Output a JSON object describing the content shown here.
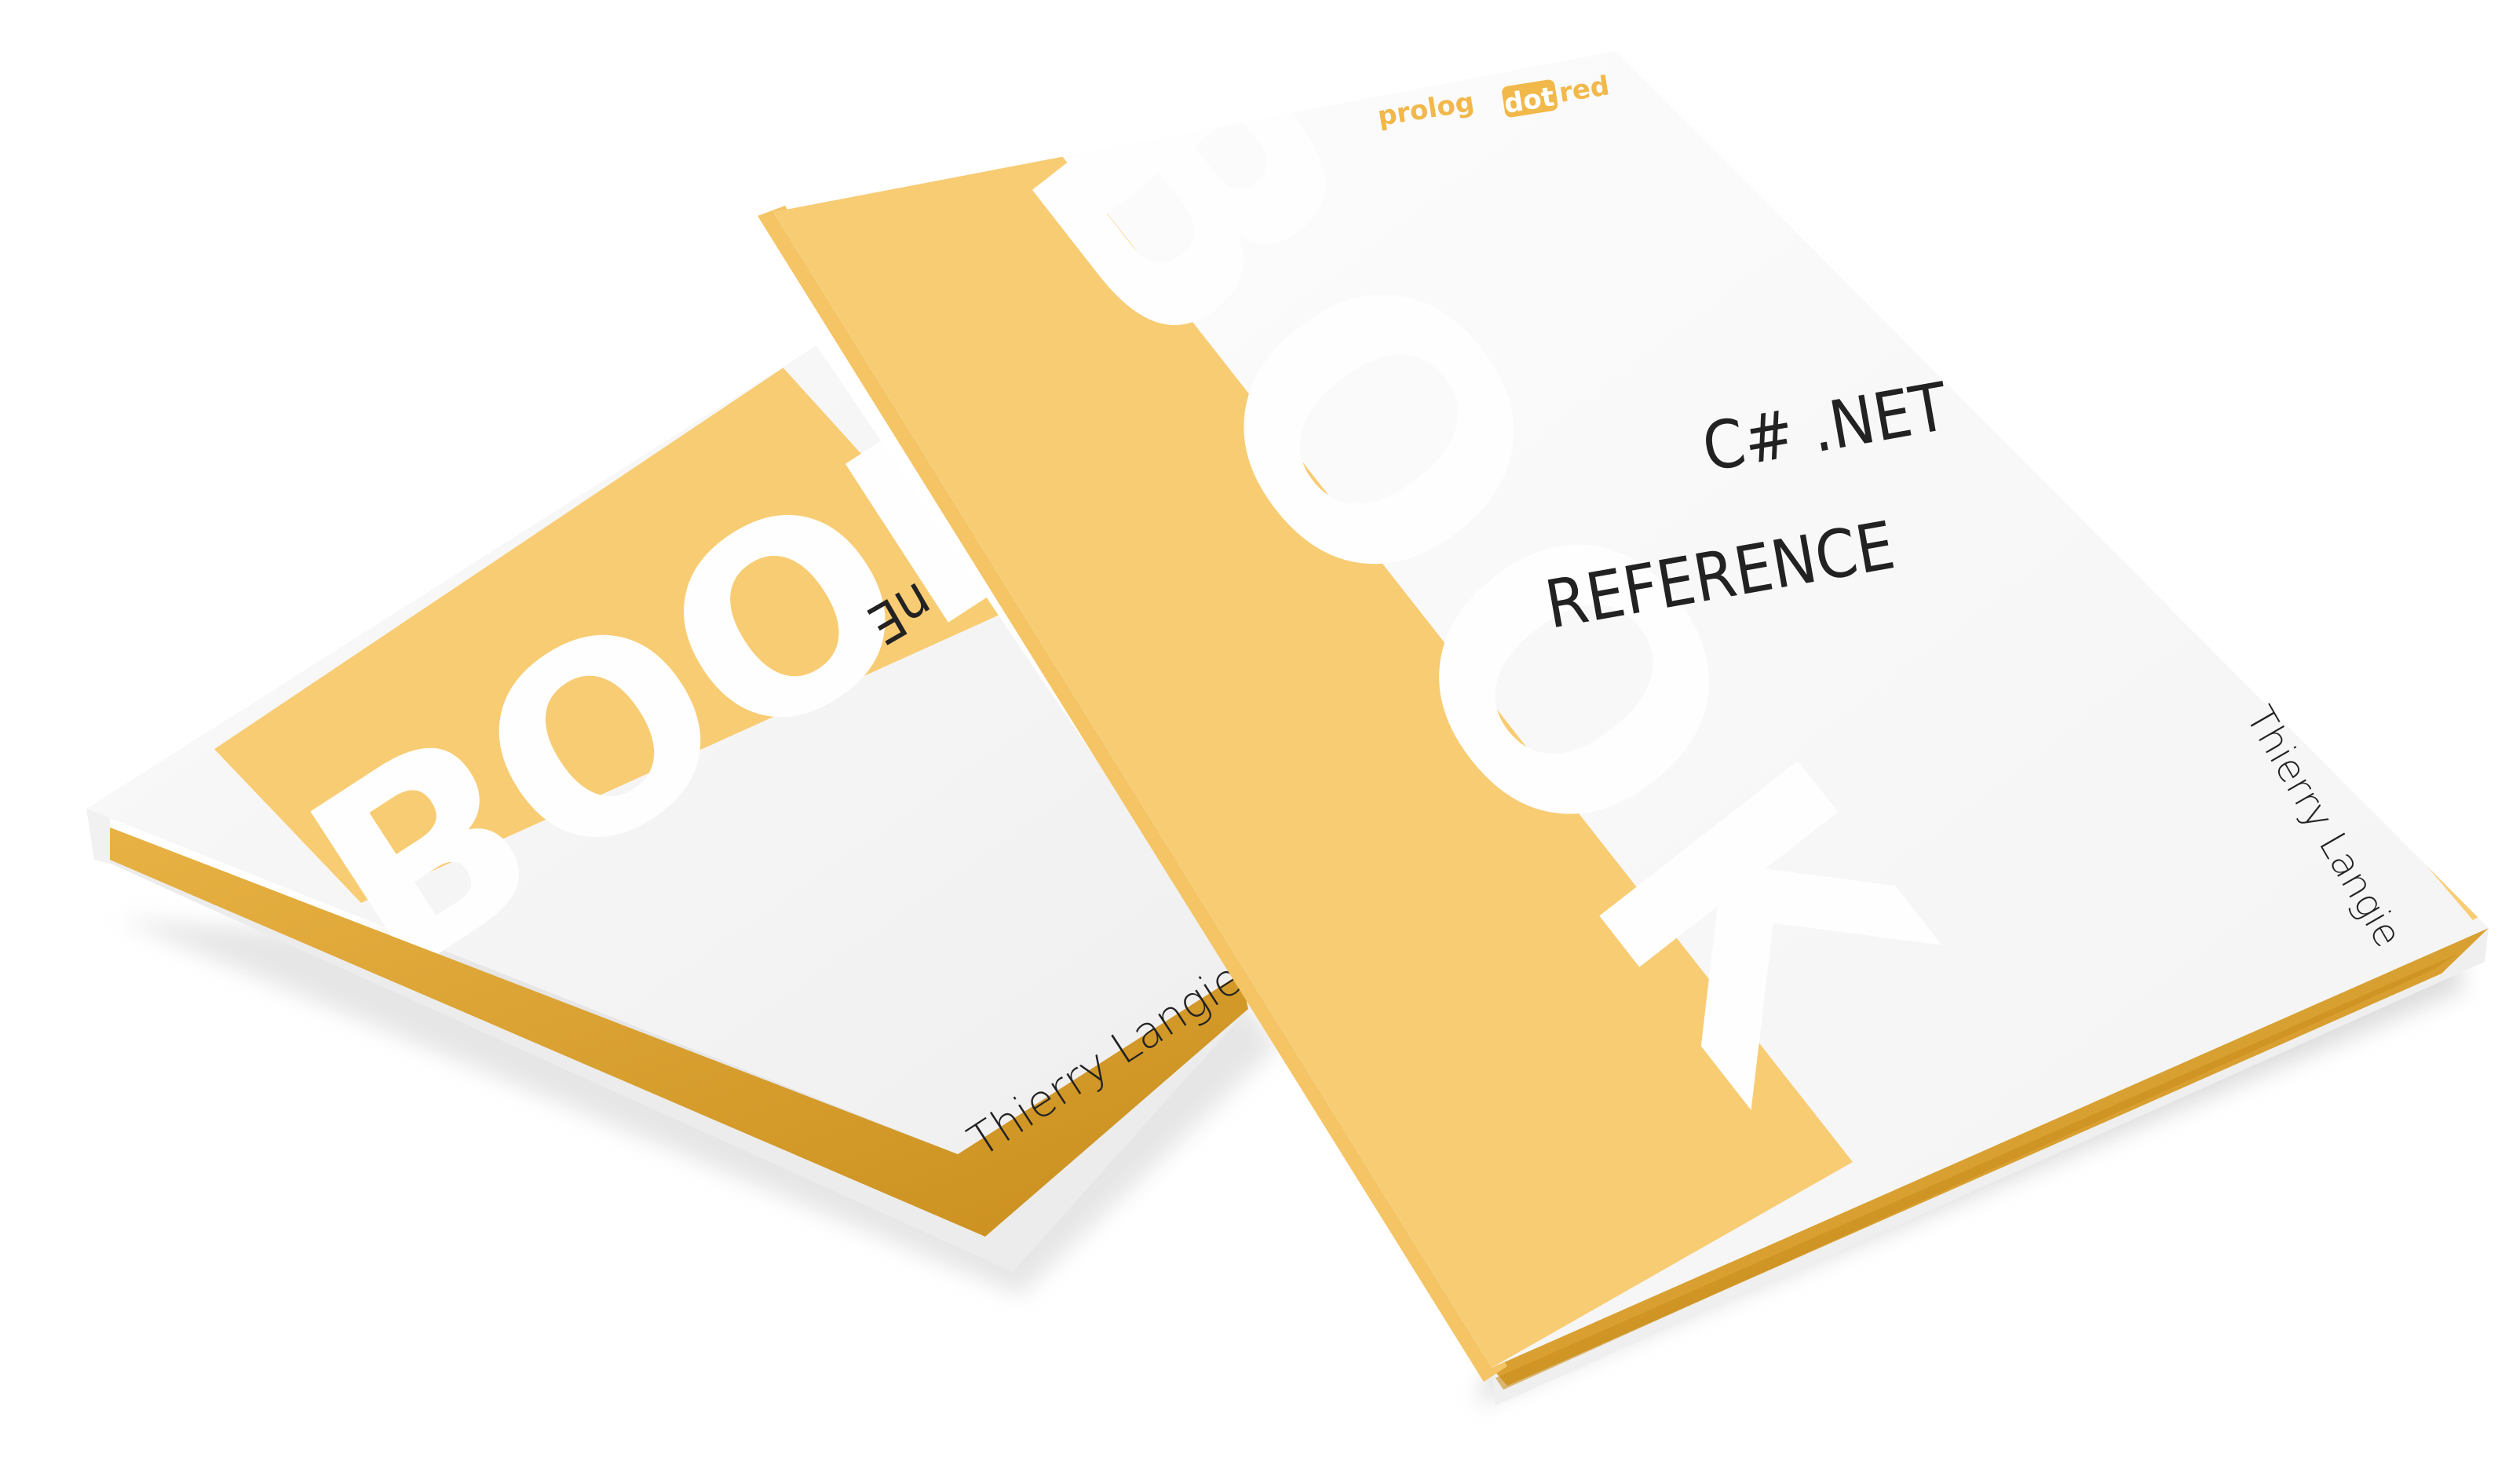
{
  "colors": {
    "background": "#ffffff",
    "cover_white": "#f9f9f9",
    "accent_yellow": "#f8cc73",
    "edge_gold": "#e3a934",
    "edge_gold_dark": "#c98e1d",
    "spine_white": "#fefefe",
    "text_dark": "#222222",
    "shadow": "#d8d8d8"
  },
  "back_book": {
    "spine_word": "BOOK",
    "author": "Thierry Langie",
    "partial_title": "nE"
  },
  "front_book": {
    "spine_word": "BOOK",
    "title_line_1": "C# .NET",
    "title_line_2": "REFERENCE",
    "author": "Thierry Langie",
    "publisher_logo": {
      "part_1": "prolog",
      "part_2": "dot",
      "part_3": "red"
    }
  }
}
